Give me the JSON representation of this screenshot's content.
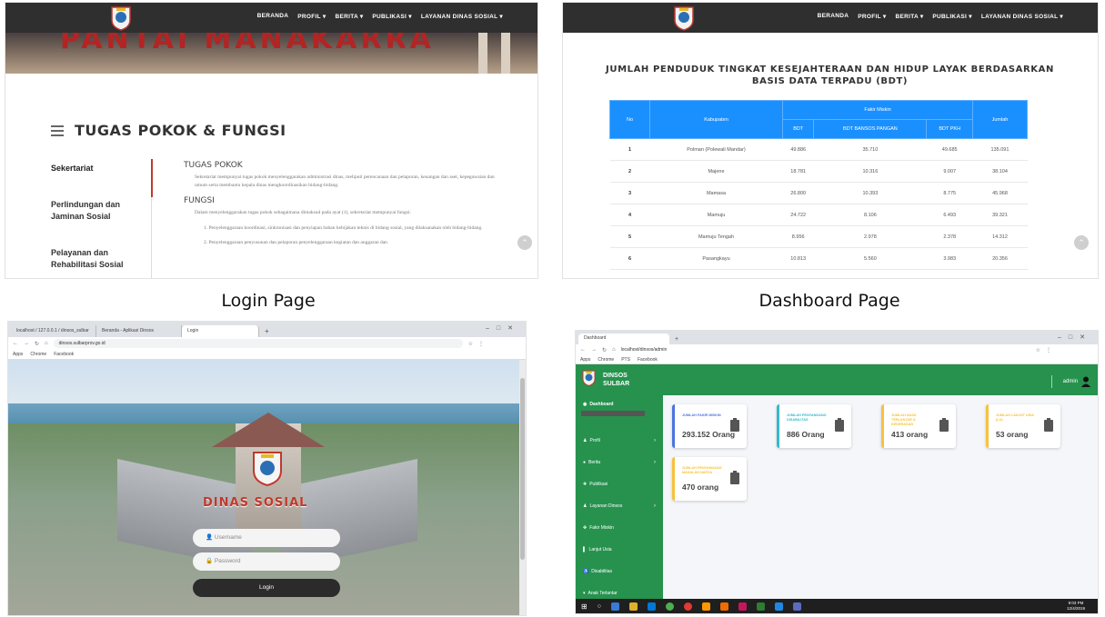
{
  "captions": {
    "login": "Login Page",
    "dashboard": "Dashboard Page"
  },
  "tugas": {
    "nav": [
      "BERANDA",
      "PROFIL ▾",
      "BERITA ▾",
      "PUBLIKASI ▾",
      "LAYANAN DINAS SOSIAL ▾"
    ],
    "banner_text": "PANTAI MANAKARRA",
    "title": "TUGAS POKOK & FUNGSI",
    "side": [
      "Sekertariat",
      "Perlindungan dan Jaminan Sosial",
      "Pelayanan dan Rehabilitasi Sosial"
    ],
    "h_pokok": "TUGAS POKOK",
    "p_pokok": "Sekretariat mempunyai tugas pokok menyelenggarakan administrasi dinas, meliputi perencanaan dan pelaporan, keuangan dan aset, kepegawaian dan umum serta membantu kepala dinas mengkoordinasikan bidang-bidang.",
    "h_fungsi": "FUNGSI",
    "p_fungsi": "Dalam menyelenggarakan tugas pokok sebagaimana dimaksud pada ayat (1), sekretariat mempunyai fungsi:",
    "p_fungsi1": "1. Penyelenggaraan koordinasi, sinkronisasi dan penyiapan bahan kebijakan teknis di bidang sosial, yang dilaksanakan oleh bidang-bidang.",
    "p_fungsi2": "2. Penyelenggaraan penyusunan dan pelaporan penyelenggaraan kegiatan dan anggaran dan"
  },
  "bdt": {
    "nav": [
      "BERANDA",
      "PROFIL ▾",
      "BERITA ▾",
      "PUBLIKASI ▾",
      "LAYANAN DINAS SOSIAL ▾"
    ],
    "title": "JUMLAH PENDUDUK TINGKAT KESEJAHTERAAN DAN HIDUP LAYAK BERDASARKAN BASIS DATA TERPADU (BDT)",
    "group_header": "Fakir Miskin",
    "headers": [
      "No",
      "Kabupaten",
      "BDT",
      "BDT BANSOS PANGAN",
      "BDT PKH",
      "Jumlah"
    ],
    "rows": [
      [
        "1",
        "Polman (Polewali Mandar)",
        "49.886",
        "35.710",
        "49.685",
        "135.091"
      ],
      [
        "2",
        "Majene",
        "18.781",
        "10.316",
        "9.007",
        "38.104"
      ],
      [
        "3",
        "Mamasa",
        "26.800",
        "10.393",
        "8.775",
        "45.968"
      ],
      [
        "4",
        "Mamuju",
        "24.722",
        "8.106",
        "6.493",
        "39.321"
      ],
      [
        "5",
        "Mamuju Tengah",
        "8.956",
        "2.978",
        "2.378",
        "14.312"
      ],
      [
        "6",
        "Pasangkayu",
        "10.813",
        "5.560",
        "3.983",
        "20.356"
      ]
    ]
  },
  "login": {
    "tabs": [
      "localhost / 127.0.0.1 / dinsos_sulbar",
      "Beranda - Aplikasi Dinsos",
      "Login"
    ],
    "url": "dinsos.sulbarprov.go.id",
    "bookmarks": [
      "Apps",
      "Chrome",
      "Facebook"
    ],
    "building_label": "DINAS SOSIAL",
    "username_placeholder": "Username",
    "password_placeholder": "Password",
    "login_label": "Login"
  },
  "admin": {
    "tab": "Dashboard",
    "url": "localhost/dinsos/admin",
    "bookmarks": [
      "Apps",
      "Chrome",
      "PTS",
      "Facebook"
    ],
    "brand_line1": "DINSOS",
    "brand_line2": "SULBAR",
    "user": "admin",
    "side": [
      "Dashboard",
      "Profil",
      "Berita",
      "Publikasi",
      "Layanan Dinsos",
      "Fakir Miskin",
      "Lanjut Usia",
      "Disabilitas",
      "Anak Terlantar"
    ],
    "cards": [
      {
        "label": "JUMLAH FAKIR MISKIN",
        "value": "293.152 Orang",
        "color": "#4e73df"
      },
      {
        "label": "JUMLAH PENYANDANG DISABILITAS",
        "value": "886 Orang",
        "color": "#36b9cc"
      },
      {
        "label": "JUMLAH ANAK TERLANTAR & KEKERASAN",
        "value": "413 orang",
        "color": "#f6c23e"
      },
      {
        "label": "JUMLAH LANJUT USIA (LU)",
        "value": "53 orang",
        "color": "#f6c23e"
      },
      {
        "label": "JUMLAH PENYANDANG MASALAH NAPZA",
        "value": "470 orang",
        "color": "#f6c23e"
      }
    ],
    "clock_time": "9:03 PM",
    "clock_date": "12/4/2019"
  }
}
